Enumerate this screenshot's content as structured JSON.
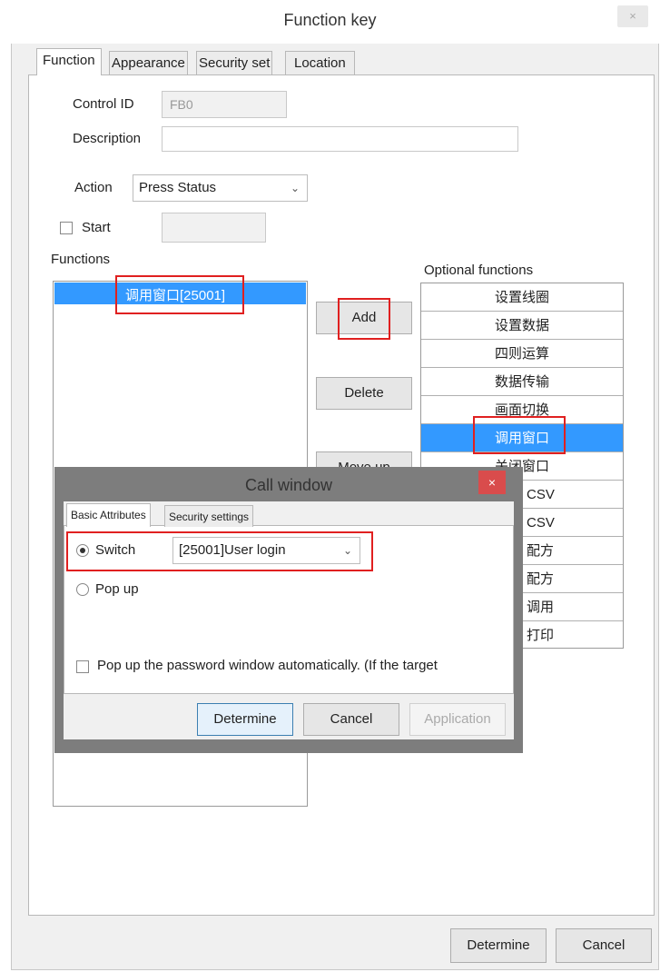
{
  "window": {
    "title": "Function key",
    "close_glyph": "×"
  },
  "tabs": [
    "Function",
    "Appearance",
    "Security set",
    "Location"
  ],
  "form": {
    "control_id_label": "Control ID",
    "control_id_value": "FB0",
    "description_label": "Description",
    "description_value": "",
    "action_label": "Action",
    "action_value": "Press Status",
    "start_label": "Start",
    "start_checked": false,
    "functions_label": "Functions"
  },
  "functions_list": {
    "items": [
      "调用窗口[25001]"
    ],
    "selected_index": 0
  },
  "middle_buttons": {
    "add": "Add",
    "delete": "Delete",
    "move_up": "Move up"
  },
  "optional_functions": {
    "label": "Optional functions",
    "items": [
      "设置线圈",
      "设置数据",
      "四则运算",
      "数据传输",
      "画面切换",
      "调用窗口",
      "关闭窗口"
    ],
    "selected_index": 5,
    "partial_visible": [
      "CSV",
      "CSV",
      "配方",
      "配方",
      "调用",
      "打印"
    ]
  },
  "call_window": {
    "title": "Call window",
    "close_glyph": "×",
    "tabs": [
      "Basic Attributes",
      "Security settings"
    ],
    "switch_label": "Switch",
    "switch_selected": true,
    "switch_value": "[25001]User login",
    "popup_label": "Pop up",
    "password_label": "Pop up the password window automatically. (If the target",
    "buttons": {
      "determine": "Determine",
      "cancel": "Cancel",
      "application": "Application"
    }
  },
  "footer": {
    "determine": "Determine",
    "cancel": "Cancel"
  },
  "colors": {
    "selection": "#3399ff",
    "highlight_box": "#e02020",
    "close_red": "#d94c4c"
  }
}
